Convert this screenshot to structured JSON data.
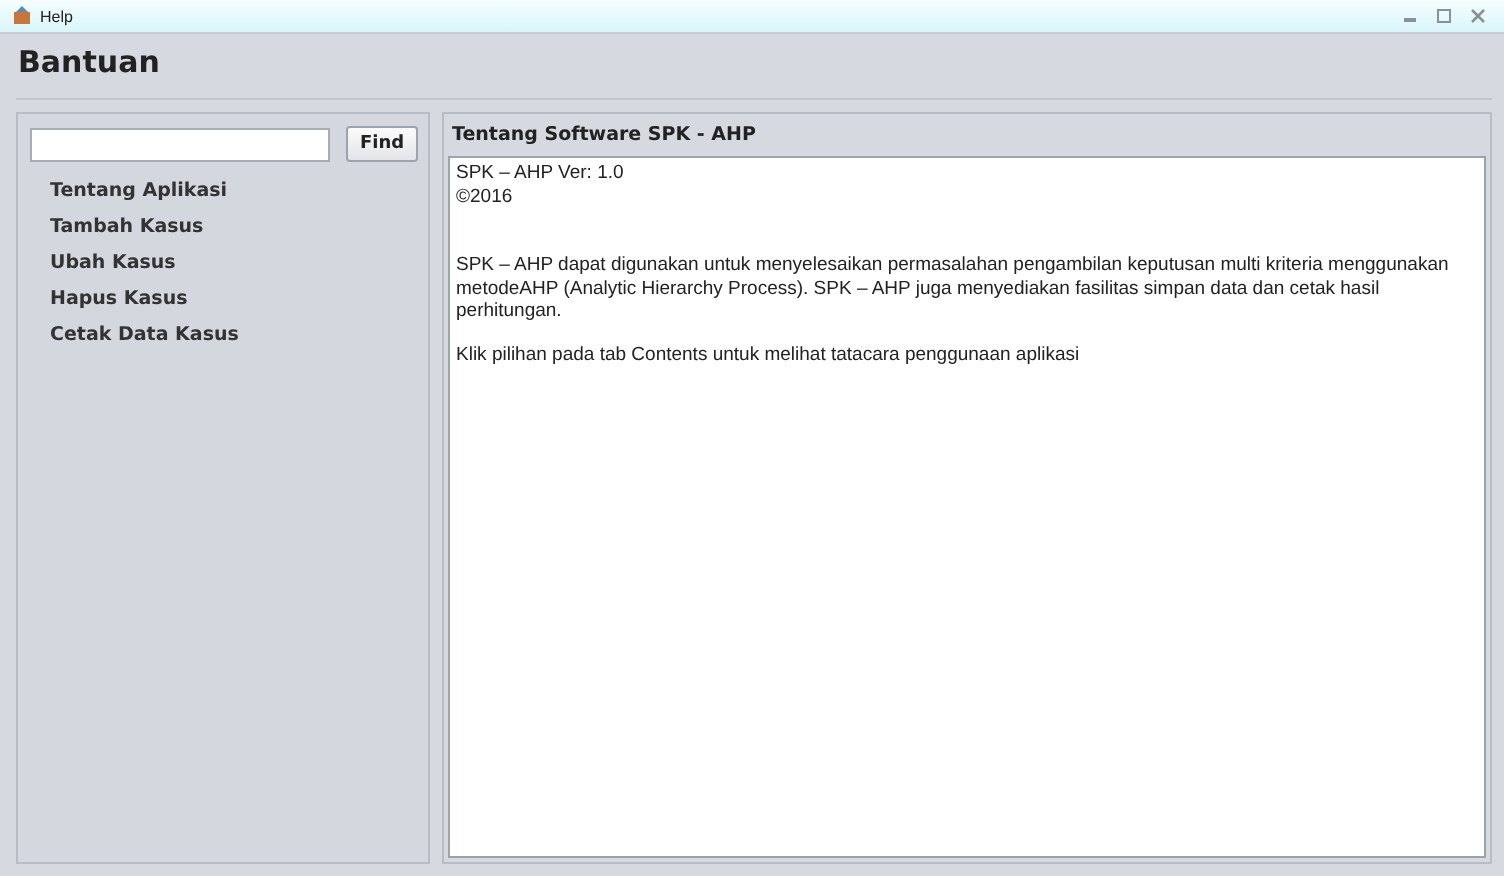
{
  "window": {
    "title": "Help"
  },
  "heading": "Bantuan",
  "search": {
    "button": "Find"
  },
  "topics": [
    {
      "label": "Tentang Aplikasi"
    },
    {
      "label": "Tambah Kasus"
    },
    {
      "label": "Ubah Kasus"
    },
    {
      "label": "Hapus Kasus"
    },
    {
      "label": "Cetak Data Kasus"
    }
  ],
  "content": {
    "title": "Tentang Software SPK - AHP",
    "lines": [
      "SPK – AHP Ver: 1.0",
      "©2016"
    ],
    "paragraphs": [
      "SPK – AHP dapat digunakan untuk menyelesaikan permasalahan pengambilan keputusan multi kriteria menggunakan metodeAHP (Analytic Hierarchy Process). SPK – AHP juga menyediakan fasilitas simpan data dan cetak hasil perhitungan.",
      "Klik pilihan pada tab Contents untuk melihat tatacara penggunaan aplikasi"
    ]
  }
}
